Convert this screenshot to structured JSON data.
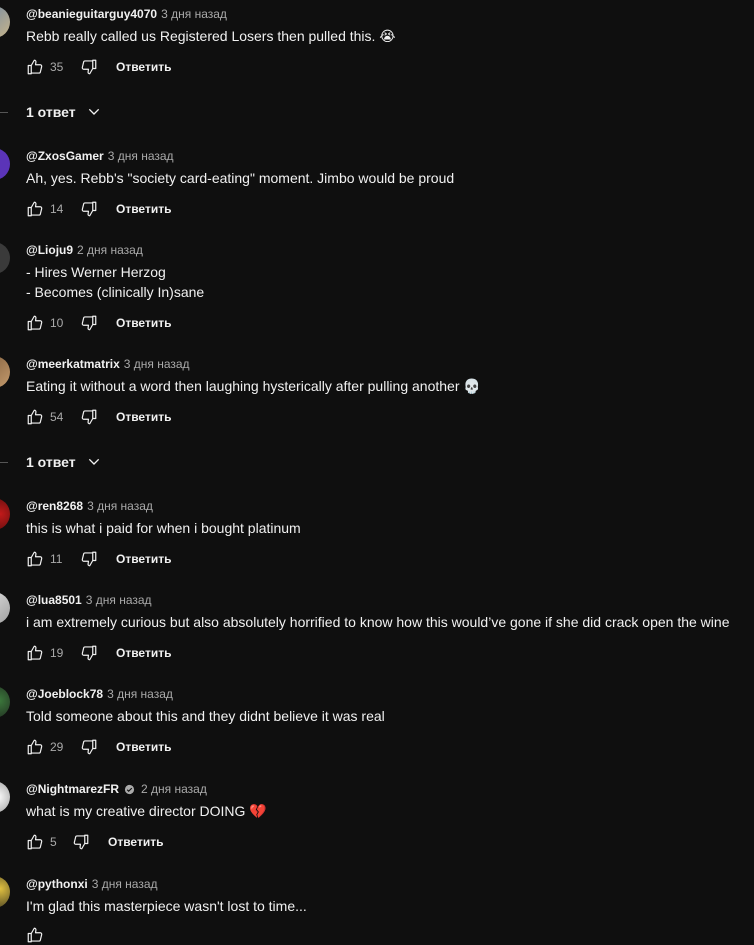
{
  "reply_label": "Ответить",
  "comments": [
    {
      "handle": "@beanieguitarguy4070",
      "time": "3 дня назад",
      "lines": [
        "Rebb really called us Registered Losers then pulled this. 😭"
      ],
      "likes": "35"
    },
    {
      "handle": "@ZxosGamer",
      "time": "3 дня назад",
      "lines": [
        "Ah, yes. Rebb's \"society card-eating\" moment. Jimbo would be proud"
      ],
      "likes": "14"
    },
    {
      "handle": "@Lioju9",
      "time": "2 дня назад",
      "lines": [
        "- Hires Werner Herzog",
        "- Becomes (clinically In)sane"
      ],
      "likes": "10"
    },
    {
      "handle": "@meerkatmatrix",
      "time": "3 дня назад",
      "lines": [
        "Eating it without a word then laughing hysterically after pulling another 💀"
      ],
      "likes": "54"
    },
    {
      "handle": "@ren8268",
      "time": "3 дня назад",
      "lines": [
        "this is what i paid for when i bought platinum"
      ],
      "likes": "11"
    },
    {
      "handle": "@lua8501",
      "time": "3 дня назад",
      "lines": [
        "i am extremely curious but also absolutely horrified to know how this would’ve gone if she did crack open the wine"
      ],
      "likes": "19"
    },
    {
      "handle": "@Joeblock78",
      "time": "3 дня назад",
      "lines": [
        "Told someone about this and they didnt believe it was real"
      ],
      "likes": "29"
    },
    {
      "handle": "@NightmarezFR",
      "time": "2 дня назад",
      "lines": [
        "what is my creative director DOING 💔"
      ],
      "likes": "5"
    },
    {
      "handle": "@pythonxi",
      "time": "3 дня назад",
      "lines": [
        "I'm glad this masterpiece wasn't lost to time..."
      ],
      "likes": ""
    }
  ],
  "replies_toggles": [
    {
      "label": "1 ответ"
    },
    {
      "label": "1 ответ"
    }
  ],
  "icons": {
    "like": "thumbs-up-icon",
    "dislike": "thumbs-down-icon",
    "expand": "chevron-down-icon",
    "verified": "verified-badge-icon"
  },
  "colors": {
    "background": "#0f0f0f",
    "text": "#f1f1f1",
    "secondary_text": "#aaaaaa"
  }
}
